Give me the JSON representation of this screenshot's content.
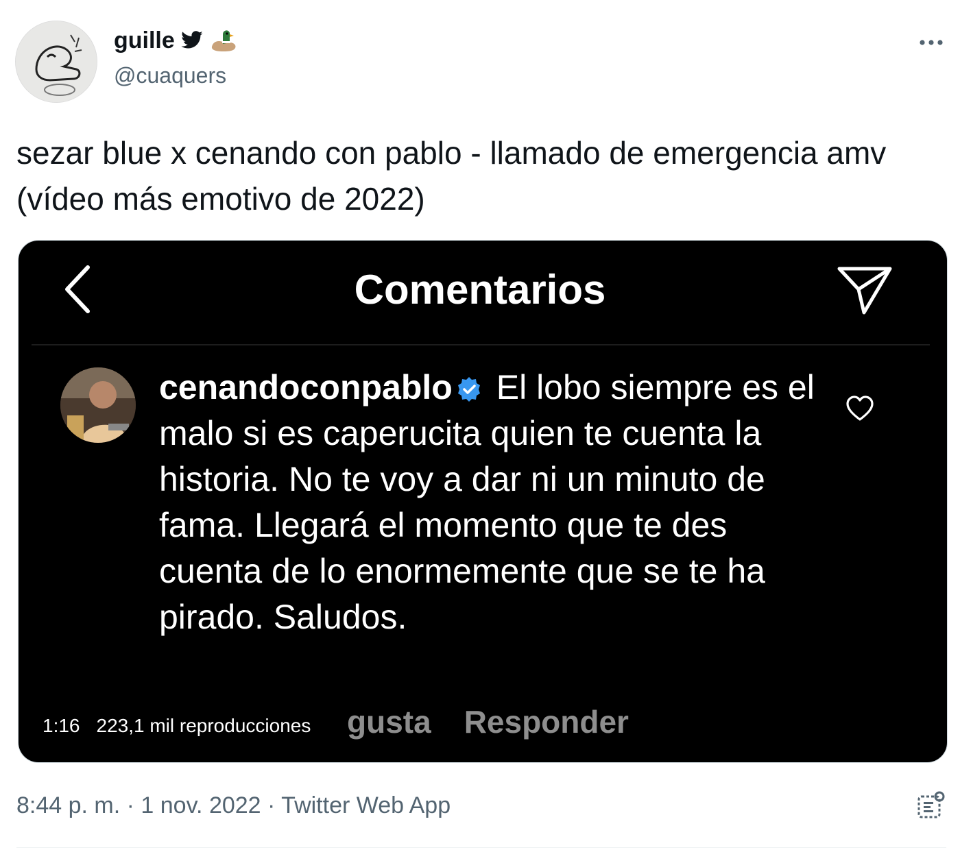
{
  "author": {
    "display_name": "guille",
    "badges": [
      "bird-icon",
      "duck-icon"
    ],
    "handle": "@cuaquers"
  },
  "tweet": {
    "text": "sezar blue x cenando con pablo - llamado de emergencia amv (vídeo más emotivo de 2022)"
  },
  "media": {
    "title": "Comentarios",
    "comment": {
      "username": "cenandoconpablo",
      "text": "El lobo siempre es el malo si es caperucita quien te cuenta la historia. No te voy a dar ni un minuto de fama. Llegará el momento que te des cuenta de lo enormemente que se te ha pirado. Saludos.",
      "actions": [
        "gusta",
        "Responder"
      ]
    },
    "video": {
      "duration": "1:16",
      "views": "223,1 mil reproducciones"
    }
  },
  "footer": {
    "meta": "8:44 p. m. · 1 nov. 2022 · Twitter Web App"
  },
  "colors": {
    "text": "#0f1419",
    "secondary": "#536471",
    "verified": "#3897f0"
  }
}
